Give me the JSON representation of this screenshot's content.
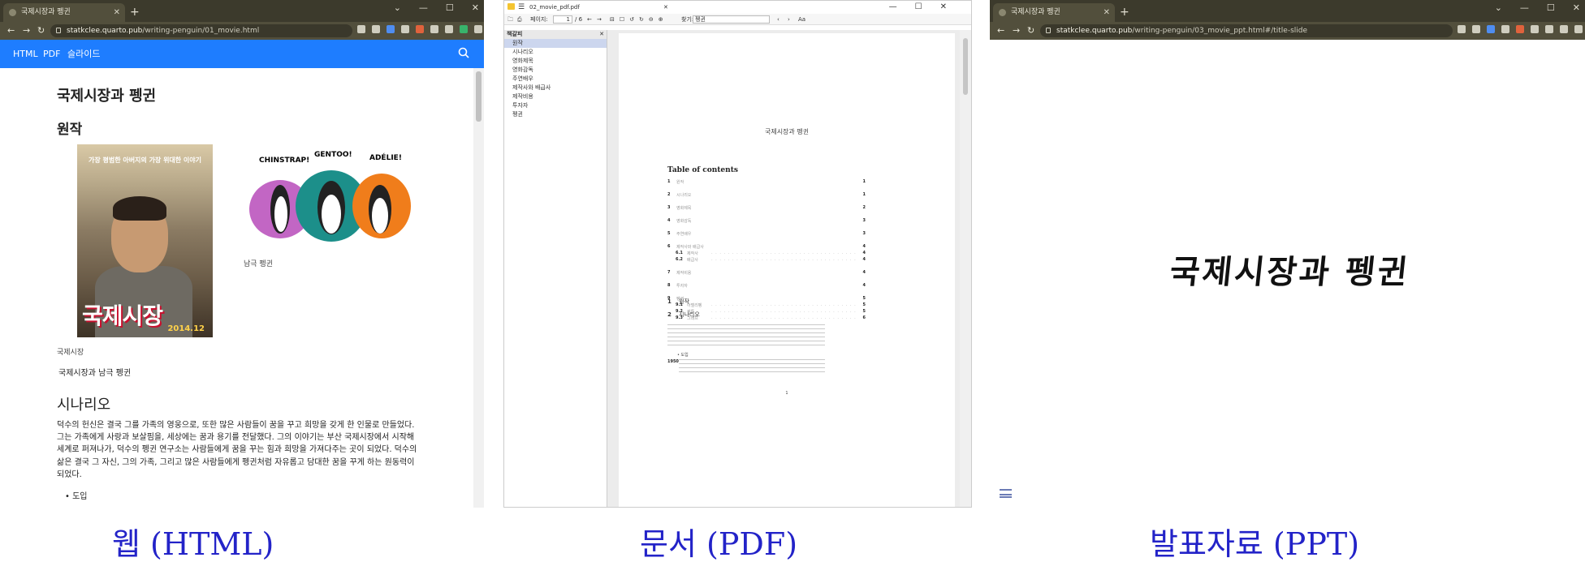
{
  "html_browser": {
    "tab_title": "국제시장과 펭귄",
    "url_host": "statkclee.quarto.pub",
    "url_path": "/writing-penguin/01_movie.html",
    "nav": [
      "HTML",
      "PDF",
      "슬라이드"
    ],
    "doc_title": "국제시장과 펭귄",
    "section_original": "원작",
    "poster_tagline": "가장 평범한 아버지의 가장 위대한 이야기",
    "poster_title": "국제시장",
    "poster_date": "2014.12",
    "penguin_labels": [
      "CHINSTRAP!",
      "GENTOO!",
      "ADÉLIE!"
    ],
    "caption_poster": "국제시장",
    "caption_penguins": "남극 펭귄",
    "figure_caption": "국제시장과 남극 펭귄",
    "section_scenario": "시나리오",
    "paragraph": "덕수의 헌신은 결국 그를 가족의 영웅으로, 또한 많은 사람들이 꿈을 꾸고 희망을 갖게 한 인물로 만들었다. 그는 가족에게 사랑과 보살핌을, 세상에는 꿈과 용기를 전달했다. 그의 이야기는 부산 국제시장에서 시작해 세계로 퍼져나가, 덕수의 펭귄 연구소는 사람들에게 꿈을 꾸는 힘과 희망을 가져다주는 곳이 되었다. 덕수의 삶은 결국 그 자신, 그의 가족, 그리고 많은 사람들에게 펭귄처럼 자유롭고 담대한 꿈을 꾸게 하는 원동력이 되었다.",
    "bullet": "도입"
  },
  "pdf_viewer": {
    "file_name": "02_movie_pdf.pdf",
    "page_label": "페이지:",
    "page_current": "1",
    "page_total": "/ 6",
    "find_label": "찾기:",
    "find_value": "펭귄",
    "sidebar_header": "책갈피",
    "bookmarks": [
      "원작",
      "시나리오",
      "영화제목",
      "영화감독",
      "주연배우",
      "제작사와 배급사",
      "제작비용",
      "투자자",
      "펭귄"
    ],
    "running_title": "국제시장과 펭귄",
    "toc_heading": "Table of contents",
    "toc": [
      {
        "n": "1",
        "t": "원작",
        "p": "1"
      },
      {
        "n": "2",
        "t": "시나리오",
        "p": "1"
      },
      {
        "n": "3",
        "t": "영화제목",
        "p": "2"
      },
      {
        "n": "4",
        "t": "영화감독",
        "p": "3"
      },
      {
        "n": "5",
        "t": "주연배우",
        "p": "3"
      },
      {
        "n": "6",
        "t": "제작사와 배급사",
        "p": "4"
      },
      {
        "n": "6.1",
        "t": "제작사",
        "p": "4"
      },
      {
        "n": "6.2",
        "t": "배급사",
        "p": "4"
      },
      {
        "n": "7",
        "t": "제작비용",
        "p": "4"
      },
      {
        "n": "8",
        "t": "투자자",
        "p": "4"
      },
      {
        "n": "9",
        "t": "펭귄",
        "p": "5"
      },
      {
        "n": "9.1",
        "t": "아델리펭",
        "p": "5"
      },
      {
        "n": "9.2",
        "t": "젠투",
        "p": "5"
      },
      {
        "n": "9.3",
        "t": "그래프",
        "p": "6"
      }
    ],
    "sec1": {
      "n": "1",
      "t": "원작"
    },
    "sec2": {
      "n": "2",
      "t": "시나리오"
    },
    "bullet": "도입",
    "para2_lead": "1950",
    "page_number": "1"
  },
  "ppt_browser": {
    "tab_title": "국제시장과 펭귄",
    "url_host": "statkclee.quarto.pub",
    "url_path": "/writing-penguin/03_movie_ppt.html#/title-slide",
    "slide_title": "국제시장과 펭귄"
  },
  "captions": {
    "html": "웹 (HTML)",
    "pdf": "문서 (PDF)",
    "ppt": "발표자료 (PPT)"
  }
}
